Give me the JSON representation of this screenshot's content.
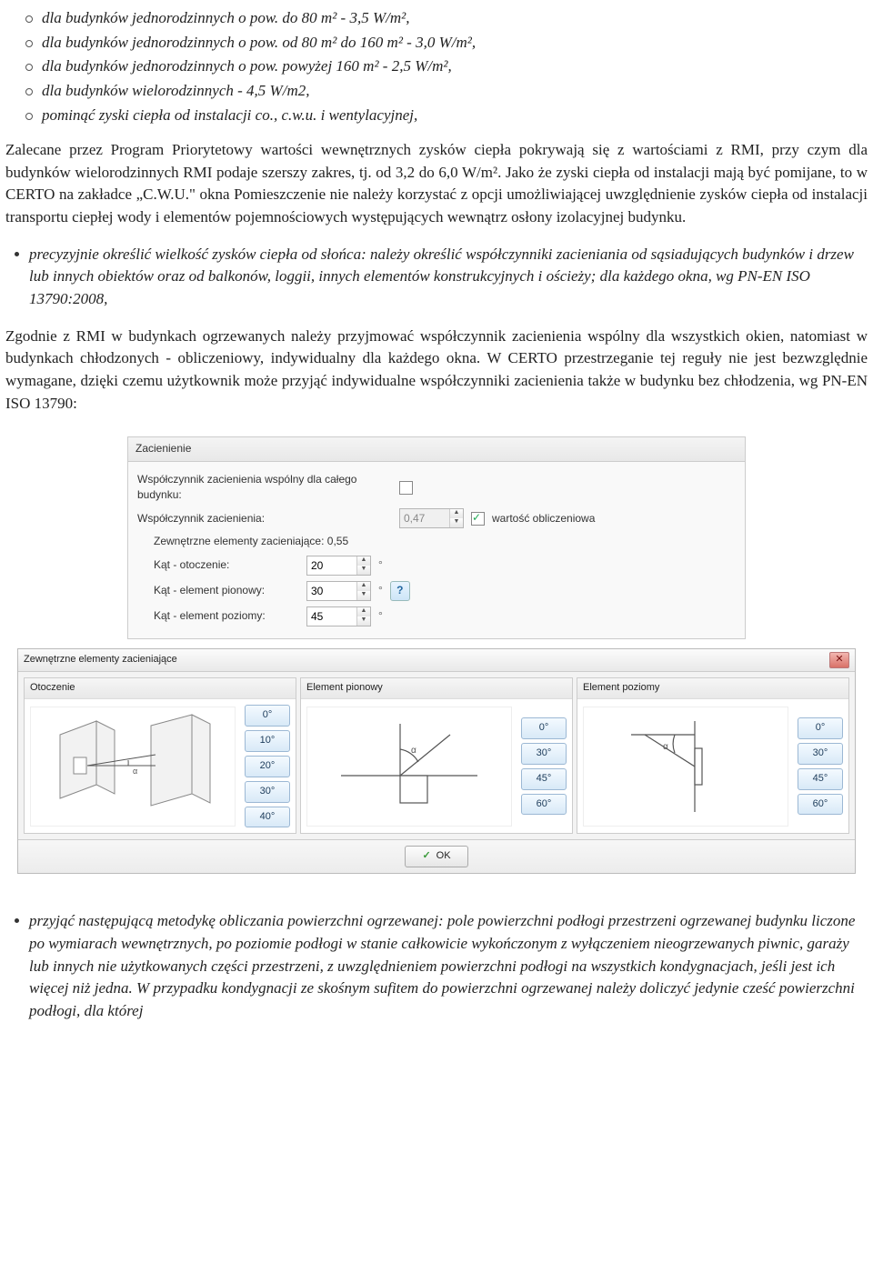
{
  "list1": {
    "i0": "dla budynków jednorodzinnych o pow. do 80 m² - 3,5 W/m²,",
    "i1": "dla budynków jednorodzinnych o pow. od 80 m² do 160 m² - 3,0 W/m²,",
    "i2": "dla budynków jednorodzinnych o pow. powyżej 160 m² - 2,5 W/m²,",
    "i3": "dla budynków wielorodzinnych - 4,5 W/m2,",
    "i4": "pominąć zyski ciepła od instalacji co., c.w.u. i wentylacyjnej,"
  },
  "para1": "Zalecane przez Program Priorytetowy wartości wewnętrznych zysków ciepła pokrywają się z wartościami z RMI, przy czym dla budynków wielorodzinnych RMI podaje szerszy zakres, tj. od 3,2 do 6,0 W/m². Jako że zyski ciepła od instalacji mają być pomijane, to w CERTO na zakładce „C.W.U.\" okna Pomieszczenie nie należy korzystać z opcji umożliwiającej uwzględnienie zysków ciepła od instalacji transportu ciepłej wody i elementów pojemnościowych występujących wewnątrz osłony izolacyjnej budynku.",
  "list2": {
    "i0": "precyzyjnie określić wielkość zysków ciepła od słońca: należy określić współczynniki zacieniania od sąsiadujących budynków i drzew lub innych obiektów oraz od balkonów, loggii, innych elementów konstrukcyjnych i ościeży; dla każdego okna, wg PN-EN ISO 13790:2008,"
  },
  "para2": "Zgodnie z RMI w budynkach ogrzewanych należy przyjmować współczynnik zacienienia wspólny dla wszystkich okien, natomiast w budynkach chłodzonych - obliczeniowy, indywidualny dla każdego okna. W CERTO przestrzeganie tej reguły nie jest bezwzględnie wymagane, dzięki czemu użytkownik może przyjąć indywidualne współczynniki zacienienia także w budynku bez chłodzenia, wg PN-EN ISO 13790:",
  "panel": {
    "title": "Zacienienie",
    "row1": "Współczynnik zacienienia wspólny dla całego budynku:",
    "row2": "Współczynnik zacienienia:",
    "row2val": "0,47",
    "row2chk": "wartość obliczeniowa",
    "sub": "Zewnętrzne elementy zacieniające: 0,55",
    "r_ot": "Kąt - otoczenie:",
    "r_ot_v": "20",
    "r_pi": "Kąt - element pionowy:",
    "r_pi_v": "30",
    "r_po": "Kąt - element poziomy:",
    "r_po_v": "45",
    "deg": "°"
  },
  "dialog": {
    "title": "Zewnętrzne elementy zacieniające",
    "col1": "Otoczenie",
    "col2": "Element pionowy",
    "col3": "Element poziomy",
    "col1btns": [
      "0°",
      "10°",
      "20°",
      "30°",
      "40°"
    ],
    "col2btns": [
      "0°",
      "30°",
      "45°",
      "60°"
    ],
    "col3btns": [
      "0°",
      "30°",
      "45°",
      "60°"
    ],
    "ok": "OK"
  },
  "list3": {
    "i0": "przyjąć następującą metodykę obliczania powierzchni ogrzewanej: pole powierzchni podłogi przestrzeni ogrzewanej budynku liczone po wymiarach wewnętrznych, po poziomie podłogi w stanie całkowicie wykończonym z wyłączeniem nieogrzewanych piwnic, garaży lub innych nie użytkowanych części przestrzeni, z uwzględnieniem powierzchni podłogi na wszystkich kondygnacjach, jeśli jest ich więcej niż jedna. W przypadku kondygnacji ze skośnym sufitem do powierzchni ogrzewanej należy doliczyć jedynie cześć powierzchni podłogi, dla której"
  }
}
